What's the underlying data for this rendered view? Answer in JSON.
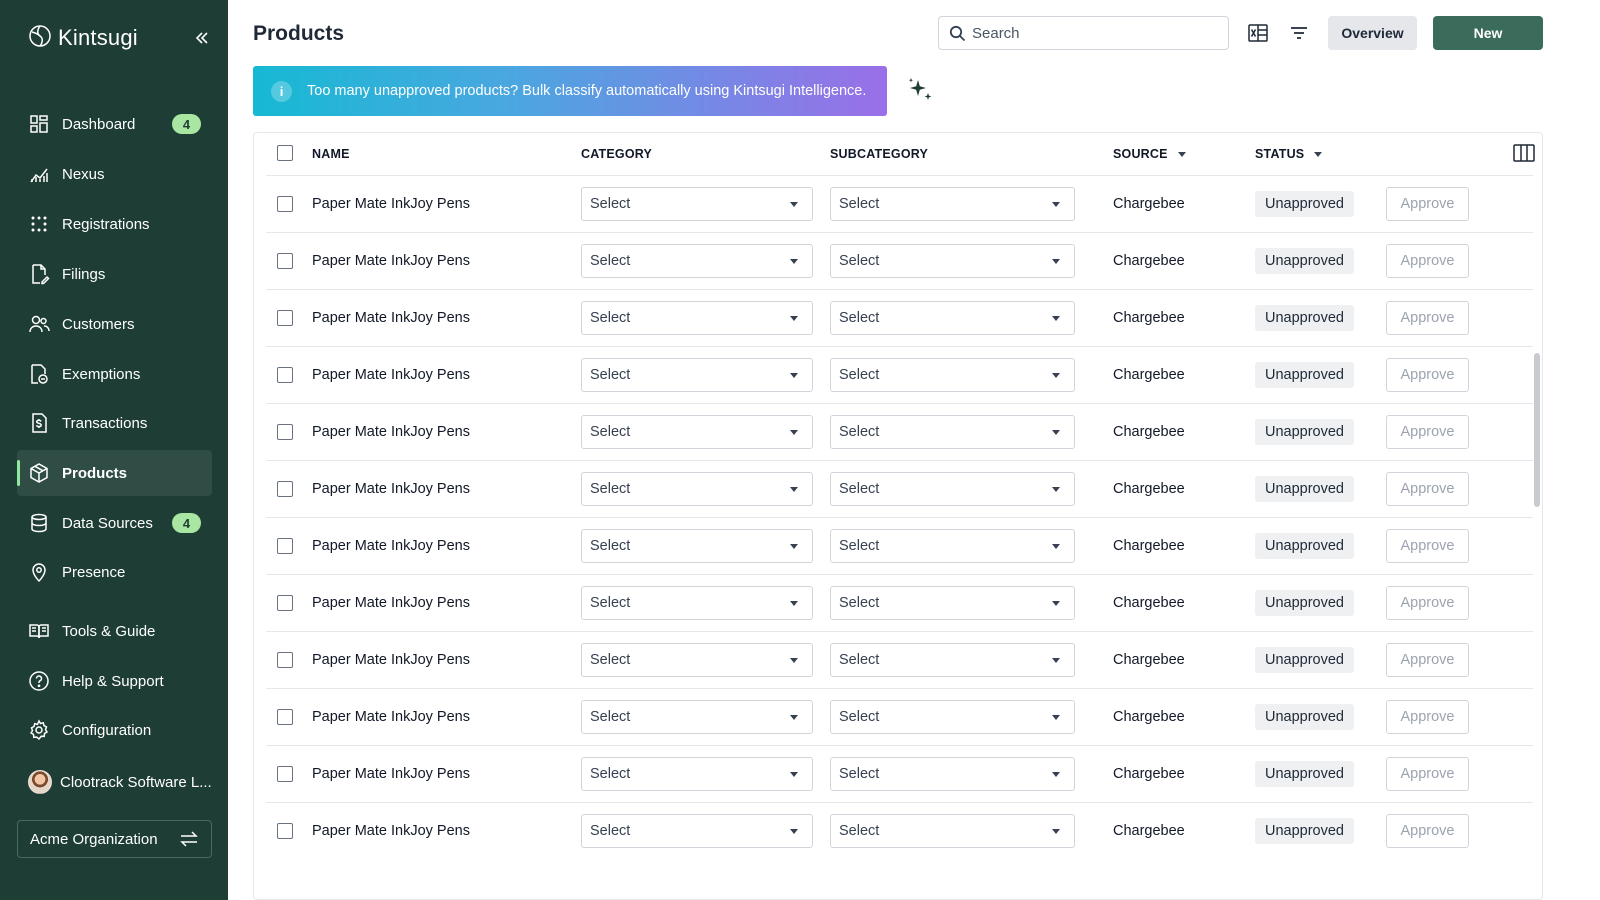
{
  "app": {
    "brand": "Kintsugi",
    "page_title": "Products"
  },
  "sidebar": {
    "items": [
      {
        "label": "Dashboard",
        "icon": "dashboard-icon",
        "badge": "4"
      },
      {
        "label": "Nexus",
        "icon": "nexus-chart-icon"
      },
      {
        "label": "Registrations",
        "icon": "registrations-icon"
      },
      {
        "label": "Filings",
        "icon": "filings-icon"
      },
      {
        "label": "Customers",
        "icon": "customers-icon"
      },
      {
        "label": "Exemptions",
        "icon": "exemptions-icon"
      },
      {
        "label": "Transactions",
        "icon": "transactions-icon"
      },
      {
        "label": "Products",
        "icon": "products-box-icon",
        "active": true
      },
      {
        "label": "Data Sources",
        "icon": "database-icon",
        "badge": "4"
      },
      {
        "label": "Presence",
        "icon": "location-pin-icon"
      },
      {
        "label": "Tools & Guide",
        "icon": "book-icon"
      },
      {
        "label": "Help & Support",
        "icon": "help-circle-icon"
      },
      {
        "label": "Configuration",
        "icon": "gear-icon"
      }
    ],
    "user": "Clootrack Software L...",
    "org": "Acme Organization"
  },
  "toolbar": {
    "search_placeholder": "Search",
    "overview_label": "Overview",
    "new_label": "New"
  },
  "banner": {
    "text": "Too many unapproved products? Bulk classify automatically using Kintsugi Intelligence."
  },
  "table": {
    "headers": {
      "name": "NAME",
      "category": "CATEGORY",
      "subcategory": "SUBCATEGORY",
      "source": "SOURCE",
      "status": "STATUS"
    },
    "rows": [
      {
        "name": "Paper Mate InkJoy Pens",
        "category": "Select",
        "subcategory": "Select",
        "source": "Chargebee",
        "status": "Unapproved",
        "action": "Approve"
      },
      {
        "name": "Paper Mate InkJoy Pens",
        "category": "Select",
        "subcategory": "Select",
        "source": "Chargebee",
        "status": "Unapproved",
        "action": "Approve"
      },
      {
        "name": "Paper Mate InkJoy Pens",
        "category": "Select",
        "subcategory": "Select",
        "source": "Chargebee",
        "status": "Unapproved",
        "action": "Approve"
      },
      {
        "name": "Paper Mate InkJoy Pens",
        "category": "Select",
        "subcategory": "Select",
        "source": "Chargebee",
        "status": "Unapproved",
        "action": "Approve"
      },
      {
        "name": "Paper Mate InkJoy Pens",
        "category": "Select",
        "subcategory": "Select",
        "source": "Chargebee",
        "status": "Unapproved",
        "action": "Approve"
      },
      {
        "name": "Paper Mate InkJoy Pens",
        "category": "Select",
        "subcategory": "Select",
        "source": "Chargebee",
        "status": "Unapproved",
        "action": "Approve"
      },
      {
        "name": "Paper Mate InkJoy Pens",
        "category": "Select",
        "subcategory": "Select",
        "source": "Chargebee",
        "status": "Unapproved",
        "action": "Approve"
      },
      {
        "name": "Paper Mate InkJoy Pens",
        "category": "Select",
        "subcategory": "Select",
        "source": "Chargebee",
        "status": "Unapproved",
        "action": "Approve"
      },
      {
        "name": "Paper Mate InkJoy Pens",
        "category": "Select",
        "subcategory": "Select",
        "source": "Chargebee",
        "status": "Unapproved",
        "action": "Approve"
      },
      {
        "name": "Paper Mate InkJoy Pens",
        "category": "Select",
        "subcategory": "Select",
        "source": "Chargebee",
        "status": "Unapproved",
        "action": "Approve"
      },
      {
        "name": "Paper Mate InkJoy Pens",
        "category": "Select",
        "subcategory": "Select",
        "source": "Chargebee",
        "status": "Unapproved",
        "action": "Approve"
      },
      {
        "name": "Paper Mate InkJoy Pens",
        "category": "Select",
        "subcategory": "Select",
        "source": "Chargebee",
        "status": "Unapproved",
        "action": "Approve"
      }
    ]
  },
  "colors": {
    "sidebar_bg": "#1e3d34",
    "accent": "#3a6b5b",
    "badge": "#a8e6a1",
    "banner_start": "#16b9d3",
    "banner_end": "#9a6fe8"
  }
}
